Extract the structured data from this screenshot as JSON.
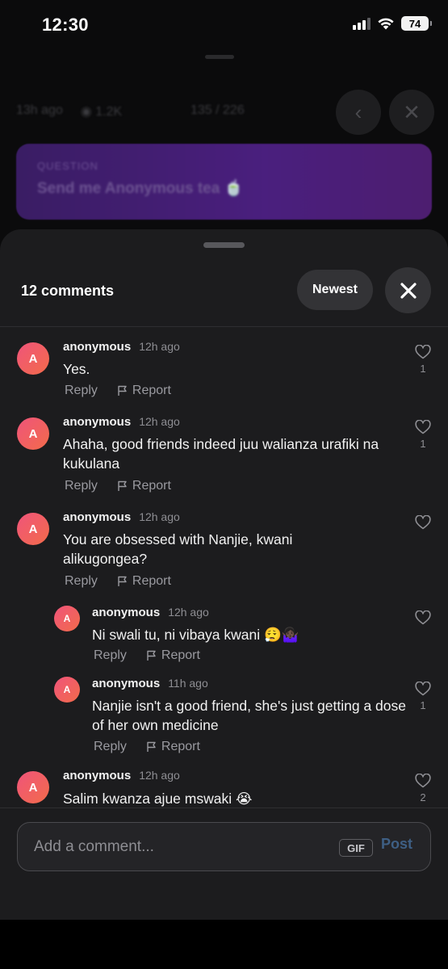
{
  "status_bar": {
    "time": "12:30",
    "battery": "74"
  },
  "background": {
    "age": "13h ago",
    "views": "1.2K",
    "pager": "135 / 226",
    "question_label": "QUESTION",
    "question_text": "Send me Anonymous tea 🍵"
  },
  "sheet": {
    "title": "12 comments",
    "sort_label": "Newest"
  },
  "comments": [
    {
      "author": "anonymous",
      "time": "12h ago",
      "text": "Yes.",
      "likes": "1",
      "reply": "Reply",
      "report": "Report"
    },
    {
      "author": "anonymous",
      "time": "12h ago",
      "text": "Ahaha, good friends indeed juu walianza urafiki na kukulana",
      "likes": "1",
      "reply": "Reply",
      "report": "Report"
    },
    {
      "author": "anonymous",
      "time": "12h ago",
      "text": "You are obsessed with Nanjie, kwani alikugongea?",
      "likes": "",
      "reply": "Reply",
      "report": "Report"
    },
    {
      "author": "anonymous",
      "time": "12h ago",
      "text": "Ni swali tu, ni vibaya kwani 😮‍💨🤷🏿‍♀️",
      "likes": "",
      "reply": "Reply",
      "report": "Report"
    },
    {
      "author": "anonymous",
      "time": "11h ago",
      "text": "Nanjie isn't a good friend, she's just getting a dose of her own medicine",
      "likes": "1",
      "reply": "Reply",
      "report": "Report"
    },
    {
      "author": "anonymous",
      "time": "12h ago",
      "text": "Salim kwanza ajue mswaki 😭",
      "likes": "2",
      "reply": "Reply",
      "report": "Report"
    }
  ],
  "avatar_letter": "A",
  "composer": {
    "placeholder": "Add a comment...",
    "gif_label": "GIF",
    "post_label": "Post"
  },
  "colors": {
    "sheet_bg": "#1c1c1e",
    "avatar_gradient_start": "#f0547b",
    "avatar_gradient_end": "#f26b4a",
    "post_disabled": "#3e5f84"
  }
}
